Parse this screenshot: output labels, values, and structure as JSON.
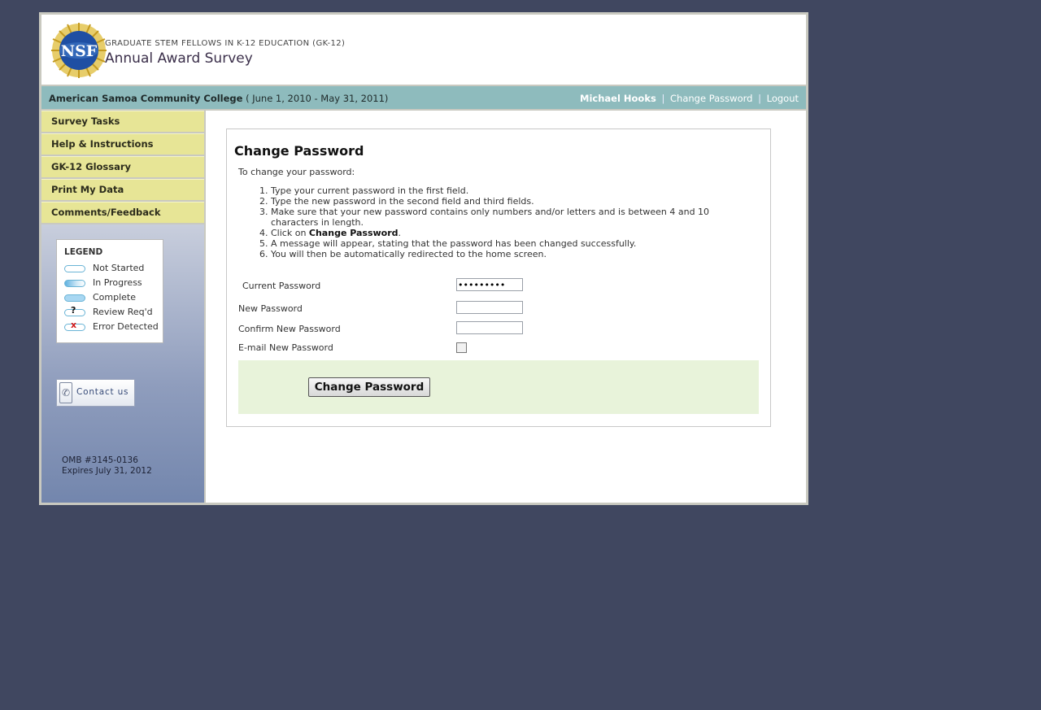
{
  "header": {
    "subtitle": "GRADUATE STEM FELLOWS IN K-12 EDUCATION (GK-12)",
    "title": "Annual Award Survey",
    "logo_text": "NSF"
  },
  "infobar": {
    "institution": "American Samoa Community College",
    "period": " ( June 1, 2010 - May 31, 2011)",
    "user_name": "Michael Hooks",
    "change_password_link": "Change Password",
    "logout_link": "Logout",
    "separator": "|"
  },
  "sidebar": {
    "nav": [
      {
        "label": "Survey Tasks"
      },
      {
        "label": "Help & Instructions"
      },
      {
        "label": "GK-12 Glossary"
      },
      {
        "label": "Print My Data"
      },
      {
        "label": "Comments/Feedback"
      }
    ],
    "legend": {
      "title": "LEGEND",
      "items": [
        {
          "label": "Not Started",
          "mark": ""
        },
        {
          "label": "In Progress",
          "mark": ""
        },
        {
          "label": "Complete",
          "mark": ""
        },
        {
          "label": "Review Req'd",
          "mark": "?"
        },
        {
          "label": "Error Detected",
          "mark": "x"
        }
      ]
    },
    "contact_label": "Contact us",
    "omb_number": "OMB #3145-0136",
    "omb_expires": "Expires July 31, 2012"
  },
  "form": {
    "heading": "Change Password",
    "intro": "To change your password:",
    "steps": [
      "Type your current password in the first field.",
      "Type the new password in the second field and third fields.",
      "Make sure that your new password contains only numbers and/or letters and is between 4 and 10 characters in length.",
      {
        "before": "Click on ",
        "bold": "Change Password",
        "after": "."
      },
      "A message will appear, stating that the password has been changed successfully.",
      "You will then be automatically redirected to the home screen."
    ],
    "fields": {
      "current_label": "Current Password",
      "current_value": "•••••••••",
      "new_label": "New Password",
      "new_value": "",
      "confirm_label": "Confirm New Password",
      "confirm_value": "",
      "email_label": "E-mail New Password",
      "email_checked": false
    },
    "submit_label": "Change Password"
  },
  "colors": {
    "background": "#404760",
    "infobar": "#8ebbbd",
    "nav": "#e7e596",
    "action_bar": "#e8f3da"
  }
}
